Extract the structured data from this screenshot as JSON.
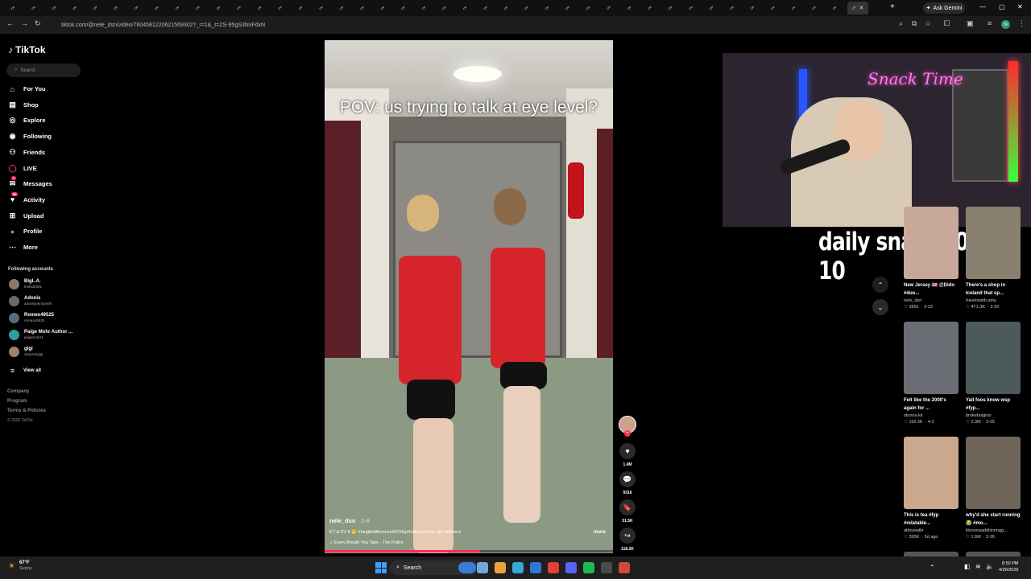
{
  "browser": {
    "tab_glyph": "♂",
    "tab_close": "✕",
    "new_tab": "+",
    "ask_gemini": "Ask Gemini",
    "url": "tiktok.com/@nele_dsn/video/7604581220621569302?_r=1&_t=ZS-95gS3NxFdxN",
    "profile_initial": "N"
  },
  "tiktok": {
    "logo": "TikTok",
    "search_placeholder": "Search",
    "nav": [
      {
        "label": "For You",
        "icon": "home-icon"
      },
      {
        "label": "Shop",
        "icon": "shop-icon"
      },
      {
        "label": "Explore",
        "icon": "compass-icon"
      },
      {
        "label": "Following",
        "icon": "following-icon"
      },
      {
        "label": "Friends",
        "icon": "friends-icon"
      },
      {
        "label": "LIVE",
        "icon": "live-icon"
      },
      {
        "label": "Messages",
        "icon": "messages-icon",
        "badge": "1"
      },
      {
        "label": "Activity",
        "icon": "activity-icon",
        "badge": "56"
      },
      {
        "label": "Upload",
        "icon": "upload-icon"
      },
      {
        "label": "Profile",
        "icon": "profile-icon"
      },
      {
        "label": "More",
        "icon": "more-icon"
      }
    ],
    "following_title": "Following accounts",
    "accounts": [
      {
        "name": "Bigl..A.",
        "handle": "thekid2891"
      },
      {
        "name": "Adonis",
        "handle": "adonisjohnson06"
      },
      {
        "name": "Romeo49525",
        "handle": "romeo49525"
      },
      {
        "name": "Paige Mohr Author ...",
        "handle": "paigemohr1"
      },
      {
        "name": "gigi",
        "handle": "okaysoiigigi"
      }
    ],
    "view_all": "View all",
    "footer": [
      "Company",
      "Program",
      "Terms & Policies",
      "© 2026 TikTok"
    ]
  },
  "video": {
    "caption": "POV: us trying to talk at eye level?",
    "author": "nele_dsn",
    "date": "· 2-8",
    "description": "6'7 & 5'2 ft 🤭 #heightdifference#67#fyp#volleyball #fy @CalliGreni",
    "more": "more",
    "music": "♫  Every Breath You Take - The Police",
    "progress_fraction": 0.54
  },
  "actions": [
    {
      "name": "like",
      "icon": "heart-icon",
      "glyph": "♥",
      "count": "1.4M"
    },
    {
      "name": "comment",
      "icon": "comment-icon",
      "glyph": "💬",
      "count": "9316"
    },
    {
      "name": "save",
      "icon": "bookmark-icon",
      "glyph": "🔖",
      "count": "51.5K"
    },
    {
      "name": "share",
      "icon": "share-icon",
      "glyph": "↪",
      "count": "118.2K"
    }
  ],
  "overlay": {
    "neon_sign": "Snack Time",
    "daily": "daily snacks  0 / 10"
  },
  "scroll": {
    "up": "⌃",
    "down": "⌄"
  },
  "grid": [
    {
      "title": "New Jersey 🇺🇸 @Dido #duo...",
      "user": "nele_dsn",
      "likes": "♡ 3991",
      "date": "· 3-22",
      "color": "#c8a89a"
    },
    {
      "title": "There's a shop in Iceland that sp...",
      "user": "travelswith.amy",
      "likes": "♡ 471.3K",
      "date": "· 3-30",
      "color": "#8a8070"
    },
    {
      "title": "Felt like the 2000's again for ...",
      "user": "stunna.kk",
      "likes": "♡ 118.3K",
      "date": "· 4-2",
      "color": "#6a6d74"
    },
    {
      "title": "Yall foos know wsp #fyp...",
      "user": "brokeboigioo",
      "likes": "♡ 2.3M",
      "date": "· 3-25",
      "color": "#4c5a5c"
    },
    {
      "title": "This is tea #fyp #relatable...",
      "user": "abbywalkr",
      "likes": "♡ 395K",
      "date": "· 5d ago",
      "color": "#c9a88e"
    },
    {
      "title": "why'd she start running😭 #mo...",
      "user": "lilooooaaddiiinnngg...",
      "likes": "♡ 1.6M",
      "date": "· 3-26",
      "color": "#6e6458"
    }
  ],
  "taskbar": {
    "temp": "67°F",
    "condition": "Sunny",
    "search": "Search",
    "time": "8:50 PM",
    "date": "4/20/2026",
    "app_colors": [
      "#3a7bd5",
      "#6fa8dc",
      "#e8a33d",
      "#38a8d8",
      "#2b79d6",
      "#e34133",
      "#5865f2",
      "#1db954",
      "#4a4a4a",
      "#d04a3a"
    ]
  }
}
